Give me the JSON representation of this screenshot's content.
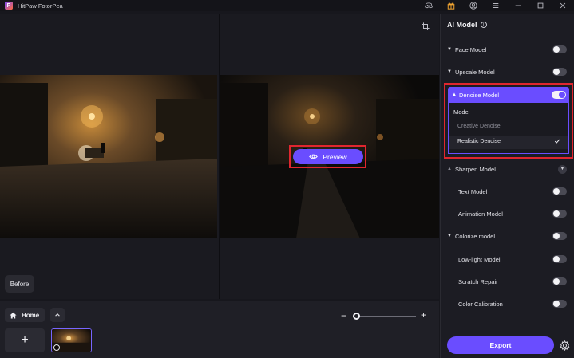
{
  "app": {
    "title": "HitPaw FotorPea",
    "logo_letter": "P"
  },
  "titlebar": {
    "icons": [
      "discord-icon",
      "gift-icon",
      "account-icon",
      "menu-icon",
      "minimize-icon",
      "maximize-icon",
      "close-icon"
    ]
  },
  "canvas": {
    "preview_label": "Preview",
    "before_label": "Before"
  },
  "bottom": {
    "home_label": "Home",
    "add_label": "+",
    "zoom_minus": "−",
    "zoom_plus": "+"
  },
  "panel": {
    "title": "AI Model",
    "info": "i",
    "items": [
      {
        "label": "Face Model",
        "toggle": false
      },
      {
        "label": "Upscale Model",
        "toggle": false
      },
      {
        "label": "Sharpen Model"
      },
      {
        "label": "Text Model",
        "toggle": false
      },
      {
        "label": "Animation Model",
        "toggle": false
      },
      {
        "label": "Colorize model",
        "toggle": false
      },
      {
        "label": "Low-light Model",
        "toggle": false
      },
      {
        "label": "Scratch Repair",
        "toggle": false
      },
      {
        "label": "Color Calibration",
        "toggle": false
      }
    ],
    "denoise": {
      "label": "Denoise Model",
      "toggle": true,
      "mode_label": "Mode",
      "options": [
        "Creative Denoise",
        "Realistic Denoise"
      ],
      "selected": "Realistic Denoise"
    },
    "export_label": "Export"
  },
  "colors": {
    "accent": "#6a4dff",
    "highlight": "#e0262f",
    "panel_bg": "#1c1c23"
  }
}
